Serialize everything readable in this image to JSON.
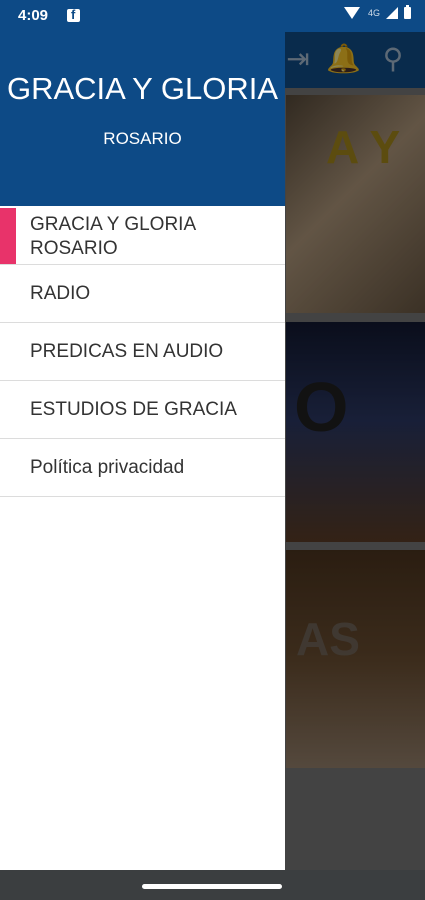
{
  "status": {
    "time": "4:09",
    "network": "4G"
  },
  "drawer": {
    "title": "GRACIA Y GLORIA",
    "subtitle": "ROSARIO",
    "items": [
      {
        "label": "GRACIA Y GLORIA ROSARIO",
        "active": true
      },
      {
        "label": "RADIO"
      },
      {
        "label": "PREDICAS EN AUDIO"
      },
      {
        "label": "ESTUDIOS DE GRACIA"
      },
      {
        "label": "Política privacidad"
      }
    ]
  },
  "background_cards": [
    {
      "text": "A Y"
    },
    {
      "text": "O"
    },
    {
      "text": "AS"
    }
  ],
  "colors": {
    "primary": "#0d4a86",
    "accent": "#e8336a",
    "scrim": "rgba(0,0,0,0.45)"
  },
  "icons": {
    "toolbar": [
      "exit-icon",
      "bell-icon",
      "search-icon"
    ]
  }
}
